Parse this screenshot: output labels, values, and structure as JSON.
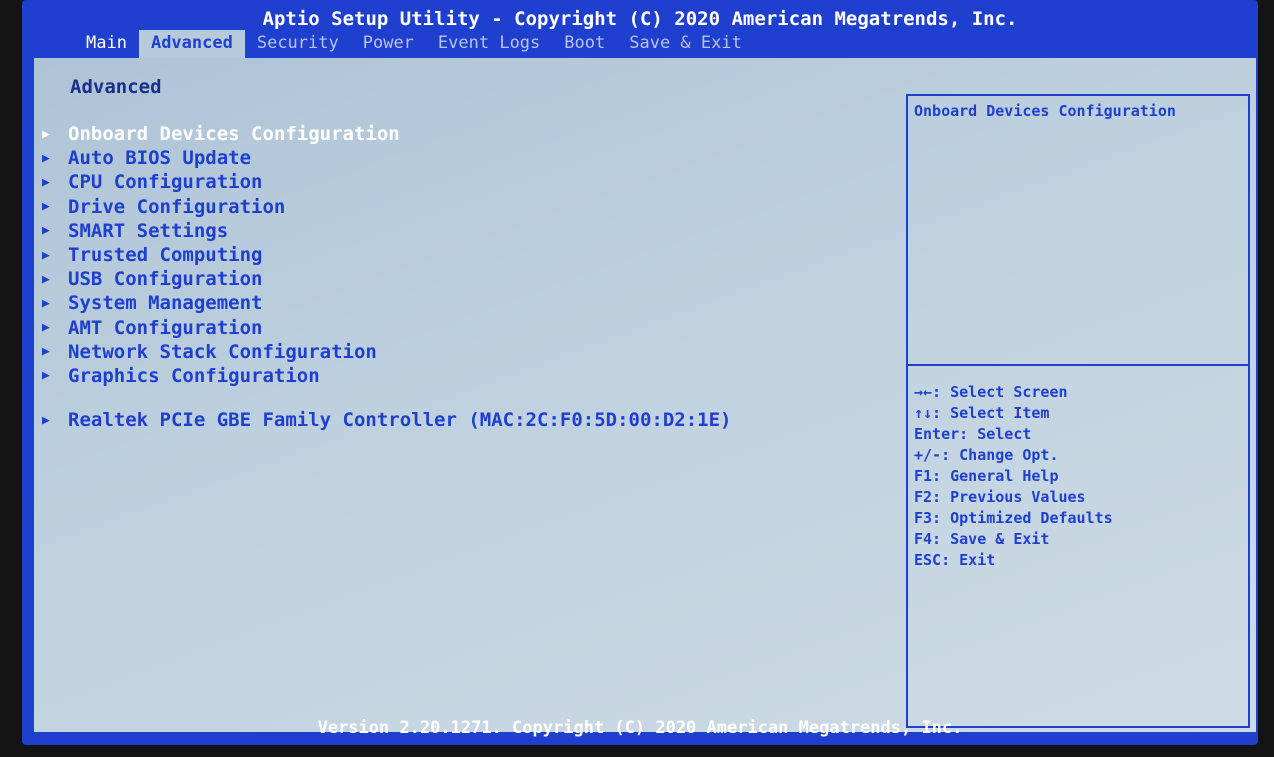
{
  "title": "Aptio Setup Utility - Copyright (C) 2020 American Megatrends, Inc.",
  "tabs": [
    {
      "label": "Main"
    },
    {
      "label": "Advanced"
    },
    {
      "label": "Security"
    },
    {
      "label": "Power"
    },
    {
      "label": "Event Logs"
    },
    {
      "label": "Boot"
    },
    {
      "label": "Save & Exit"
    }
  ],
  "page_heading": "Advanced",
  "menu_items": [
    {
      "label": "Onboard Devices Configuration"
    },
    {
      "label": "Auto BIOS Update"
    },
    {
      "label": "CPU Configuration"
    },
    {
      "label": "Drive Configuration"
    },
    {
      "label": "SMART Settings"
    },
    {
      "label": "Trusted Computing"
    },
    {
      "label": "USB Configuration"
    },
    {
      "label": "System Management"
    },
    {
      "label": "AMT Configuration"
    },
    {
      "label": "Network Stack Configuration"
    },
    {
      "label": "Graphics Configuration"
    },
    {
      "label": "Realtek PCIe GBE Family Controller (MAC:2C:F0:5D:00:D2:1E)"
    }
  ],
  "arrow_glyph": "▶",
  "help_title": "Onboard Devices Configuration",
  "key_help": [
    "→←: Select Screen",
    "↑↓: Select Item",
    "Enter: Select",
    "+/-: Change Opt.",
    "F1: General Help",
    "F2: Previous Values",
    "F3: Optimized Defaults",
    "F4: Save & Exit",
    "ESC: Exit"
  ],
  "footer": "Version 2.20.1271. Copyright (C) 2020 American Megatrends, Inc.",
  "colors": {
    "bios_blue": "#1f3fcf",
    "panel": "#bfd1df",
    "highlight": "#ffffff"
  }
}
